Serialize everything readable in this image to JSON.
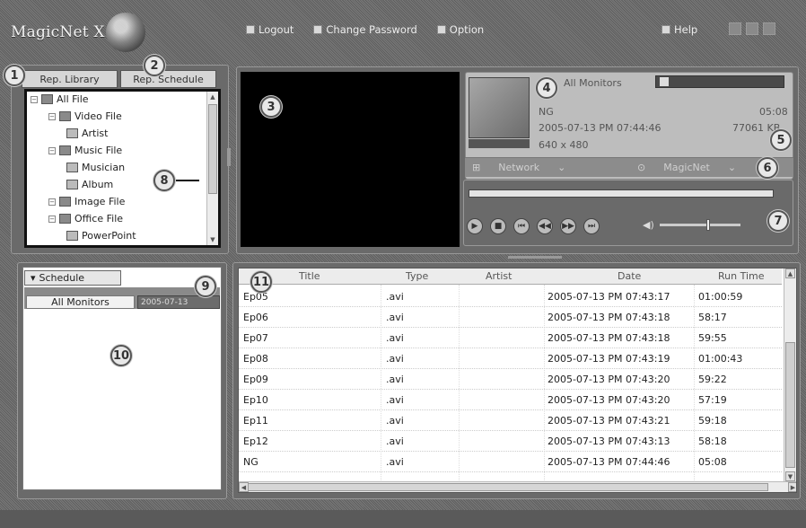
{
  "app": {
    "title": "MagicNet X"
  },
  "topmenu": {
    "logout": "Logout",
    "change_password": "Change Password",
    "option": "Option",
    "help": "Help"
  },
  "library": {
    "rep_library": "Rep. Library",
    "rep_schedule": "Rep. Schedule",
    "tree": [
      {
        "label": "All File",
        "level": 0,
        "icon": "folder-icon"
      },
      {
        "label": "Video File",
        "level": 1,
        "icon": "video-folder-icon"
      },
      {
        "label": "Artist",
        "level": 2,
        "icon": "film-icon"
      },
      {
        "label": "Music File",
        "level": 1,
        "icon": "music-folder-icon"
      },
      {
        "label": "Musician",
        "level": 2,
        "icon": "musician-icon"
      },
      {
        "label": "Album",
        "level": 2,
        "icon": "album-icon"
      },
      {
        "label": "Image File",
        "level": 1,
        "icon": "image-folder-icon"
      },
      {
        "label": "Office File",
        "level": 1,
        "icon": "office-folder-icon"
      },
      {
        "label": "PowerPoint",
        "level": 2,
        "icon": "powerpoint-icon"
      }
    ]
  },
  "info": {
    "monitor": "All Monitors",
    "name": "NG",
    "duration": "05:08",
    "date": "2005-07-13 PM 07:44:46",
    "size": "77061 KB",
    "resolution": "640 x 480",
    "network_label": "Network",
    "magicnet_label": "MagicNet"
  },
  "markers": {
    "m1": "1",
    "m2": "2",
    "m3": "3",
    "m4": "4",
    "m5": "5",
    "m6": "6",
    "m7": "7",
    "m8": "8",
    "m9": "9",
    "m10": "10",
    "m11": "11"
  },
  "schedule": {
    "tab": "Schedule",
    "all_monitors": "All Monitors",
    "date": "2005-07-13"
  },
  "table": {
    "headers": [
      "Title",
      "Type",
      "Artist",
      "Date",
      "Run Time"
    ],
    "rows": [
      {
        "title": "Ep05",
        "type": ".avi",
        "artist": "",
        "date": "2005-07-13 PM 07:43:17",
        "run_time": "01:00:59"
      },
      {
        "title": "Ep06",
        "type": ".avi",
        "artist": "",
        "date": "2005-07-13 PM 07:43:18",
        "run_time": "58:17"
      },
      {
        "title": "Ep07",
        "type": ".avi",
        "artist": "",
        "date": "2005-07-13 PM 07:43:18",
        "run_time": "59:55"
      },
      {
        "title": "Ep08",
        "type": ".avi",
        "artist": "",
        "date": "2005-07-13 PM 07:43:19",
        "run_time": "01:00:43"
      },
      {
        "title": "Ep09",
        "type": ".avi",
        "artist": "",
        "date": "2005-07-13 PM 07:43:20",
        "run_time": "59:22"
      },
      {
        "title": "Ep10",
        "type": ".avi",
        "artist": "",
        "date": "2005-07-13 PM 07:43:20",
        "run_time": "57:19"
      },
      {
        "title": "Ep11",
        "type": ".avi",
        "artist": "",
        "date": "2005-07-13 PM 07:43:21",
        "run_time": "59:18"
      },
      {
        "title": "Ep12",
        "type": ".avi",
        "artist": "",
        "date": "2005-07-13 PM 07:43:13",
        "run_time": "58:18"
      },
      {
        "title": "NG",
        "type": ".avi",
        "artist": "",
        "date": "2005-07-13 PM 07:44:46",
        "run_time": "05:08"
      }
    ]
  },
  "player": {
    "volume": 0.6,
    "progress": 0.0
  }
}
